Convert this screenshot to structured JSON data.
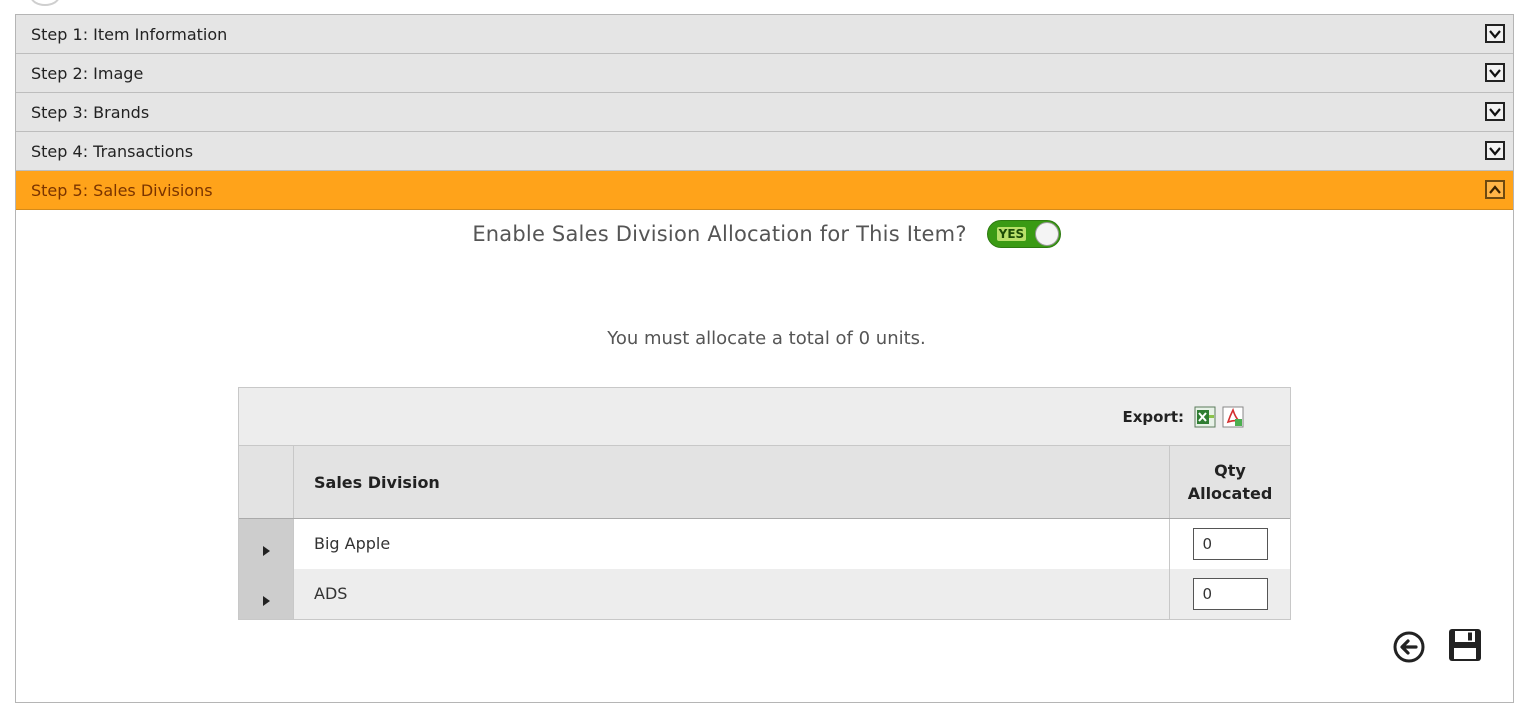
{
  "steps": [
    {
      "label": "Step 1: Item Information",
      "state": "collapsed"
    },
    {
      "label": "Step 2: Image",
      "state": "collapsed"
    },
    {
      "label": "Step 3: Brands",
      "state": "collapsed"
    },
    {
      "label": "Step 4: Transactions",
      "state": "collapsed"
    },
    {
      "label": "Step 5: Sales Divisions",
      "state": "expanded"
    }
  ],
  "sales_divisions": {
    "enable_label": "Enable Sales Division Allocation for This Item?",
    "enable_toggle": "YES",
    "allocation_message": "You must allocate a total of 0 units.",
    "export_label": "Export:",
    "columns": {
      "name": "Sales Division",
      "qty": "Qty Allocated"
    },
    "rows": [
      {
        "name": "Big Apple",
        "qty": "0"
      },
      {
        "name": "ADS",
        "qty": "0"
      }
    ]
  },
  "colors": {
    "active_step": "#ffa31a",
    "toggle_on": "#3a9a14"
  },
  "icons": [
    "chevron-down-icon",
    "chevron-up-icon",
    "excel-export-icon",
    "pdf-export-icon",
    "back-arrow-icon",
    "save-icon"
  ]
}
